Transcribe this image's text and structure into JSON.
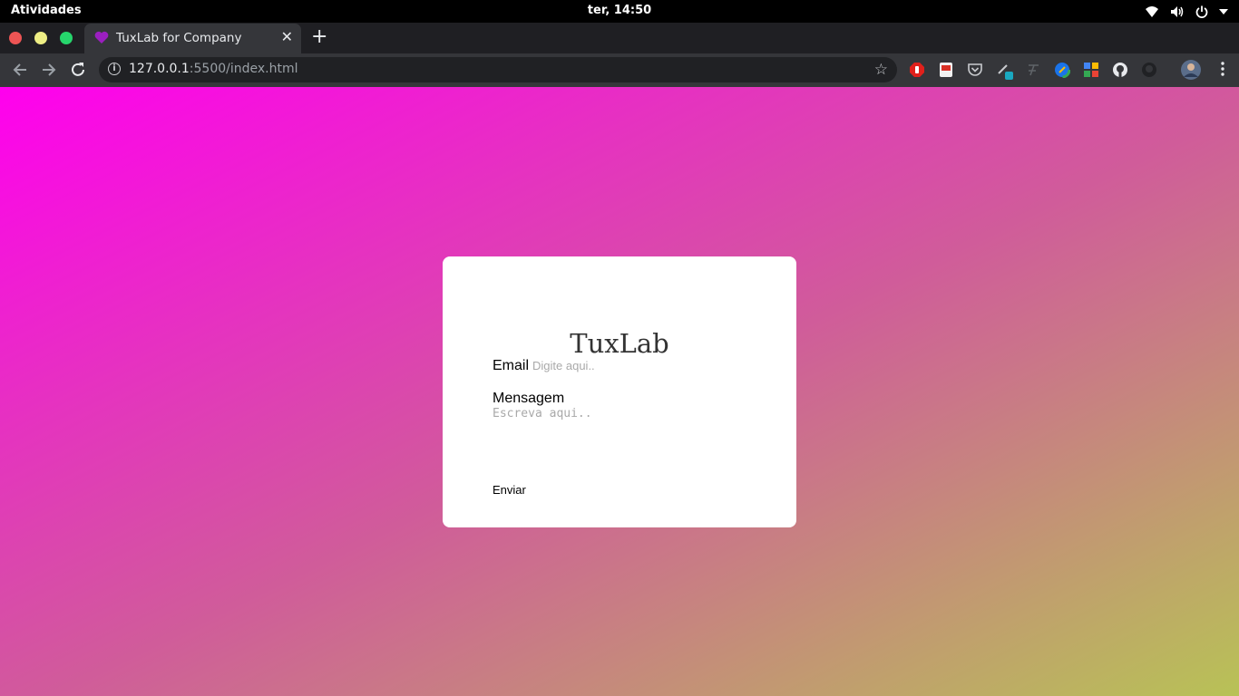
{
  "system_bar": {
    "activities": "Atividades",
    "clock": "ter, 14:50",
    "tray_icons": [
      "wifi-icon",
      "volume-icon",
      "power-icon",
      "chevron-down-icon"
    ]
  },
  "browser": {
    "tab": {
      "title": "TuxLab for Company",
      "favicon": "purple-heart-icon",
      "favicon_color": "#9b1fbf"
    },
    "url": {
      "host": "127.0.0.1",
      "rest": ":5500/index.html"
    },
    "extensions": [
      "adblock-icon",
      "pdf-icon",
      "pocket-icon",
      "color-picker-icon",
      "font-icon",
      "speedtest-icon",
      "grid-app-icon",
      "github-icon",
      "github-dark-icon",
      "profile-avatar"
    ]
  },
  "page": {
    "background_colors": [
      "#ff00ee",
      "#d05c9a",
      "#b8c256"
    ],
    "form": {
      "brand": "TuxLab",
      "email_label": "Email",
      "email_placeholder": "Digite aqui..",
      "message_label": "Mensagem",
      "message_placeholder": "Escreva aqui..",
      "submit_label": "Enviar"
    }
  }
}
